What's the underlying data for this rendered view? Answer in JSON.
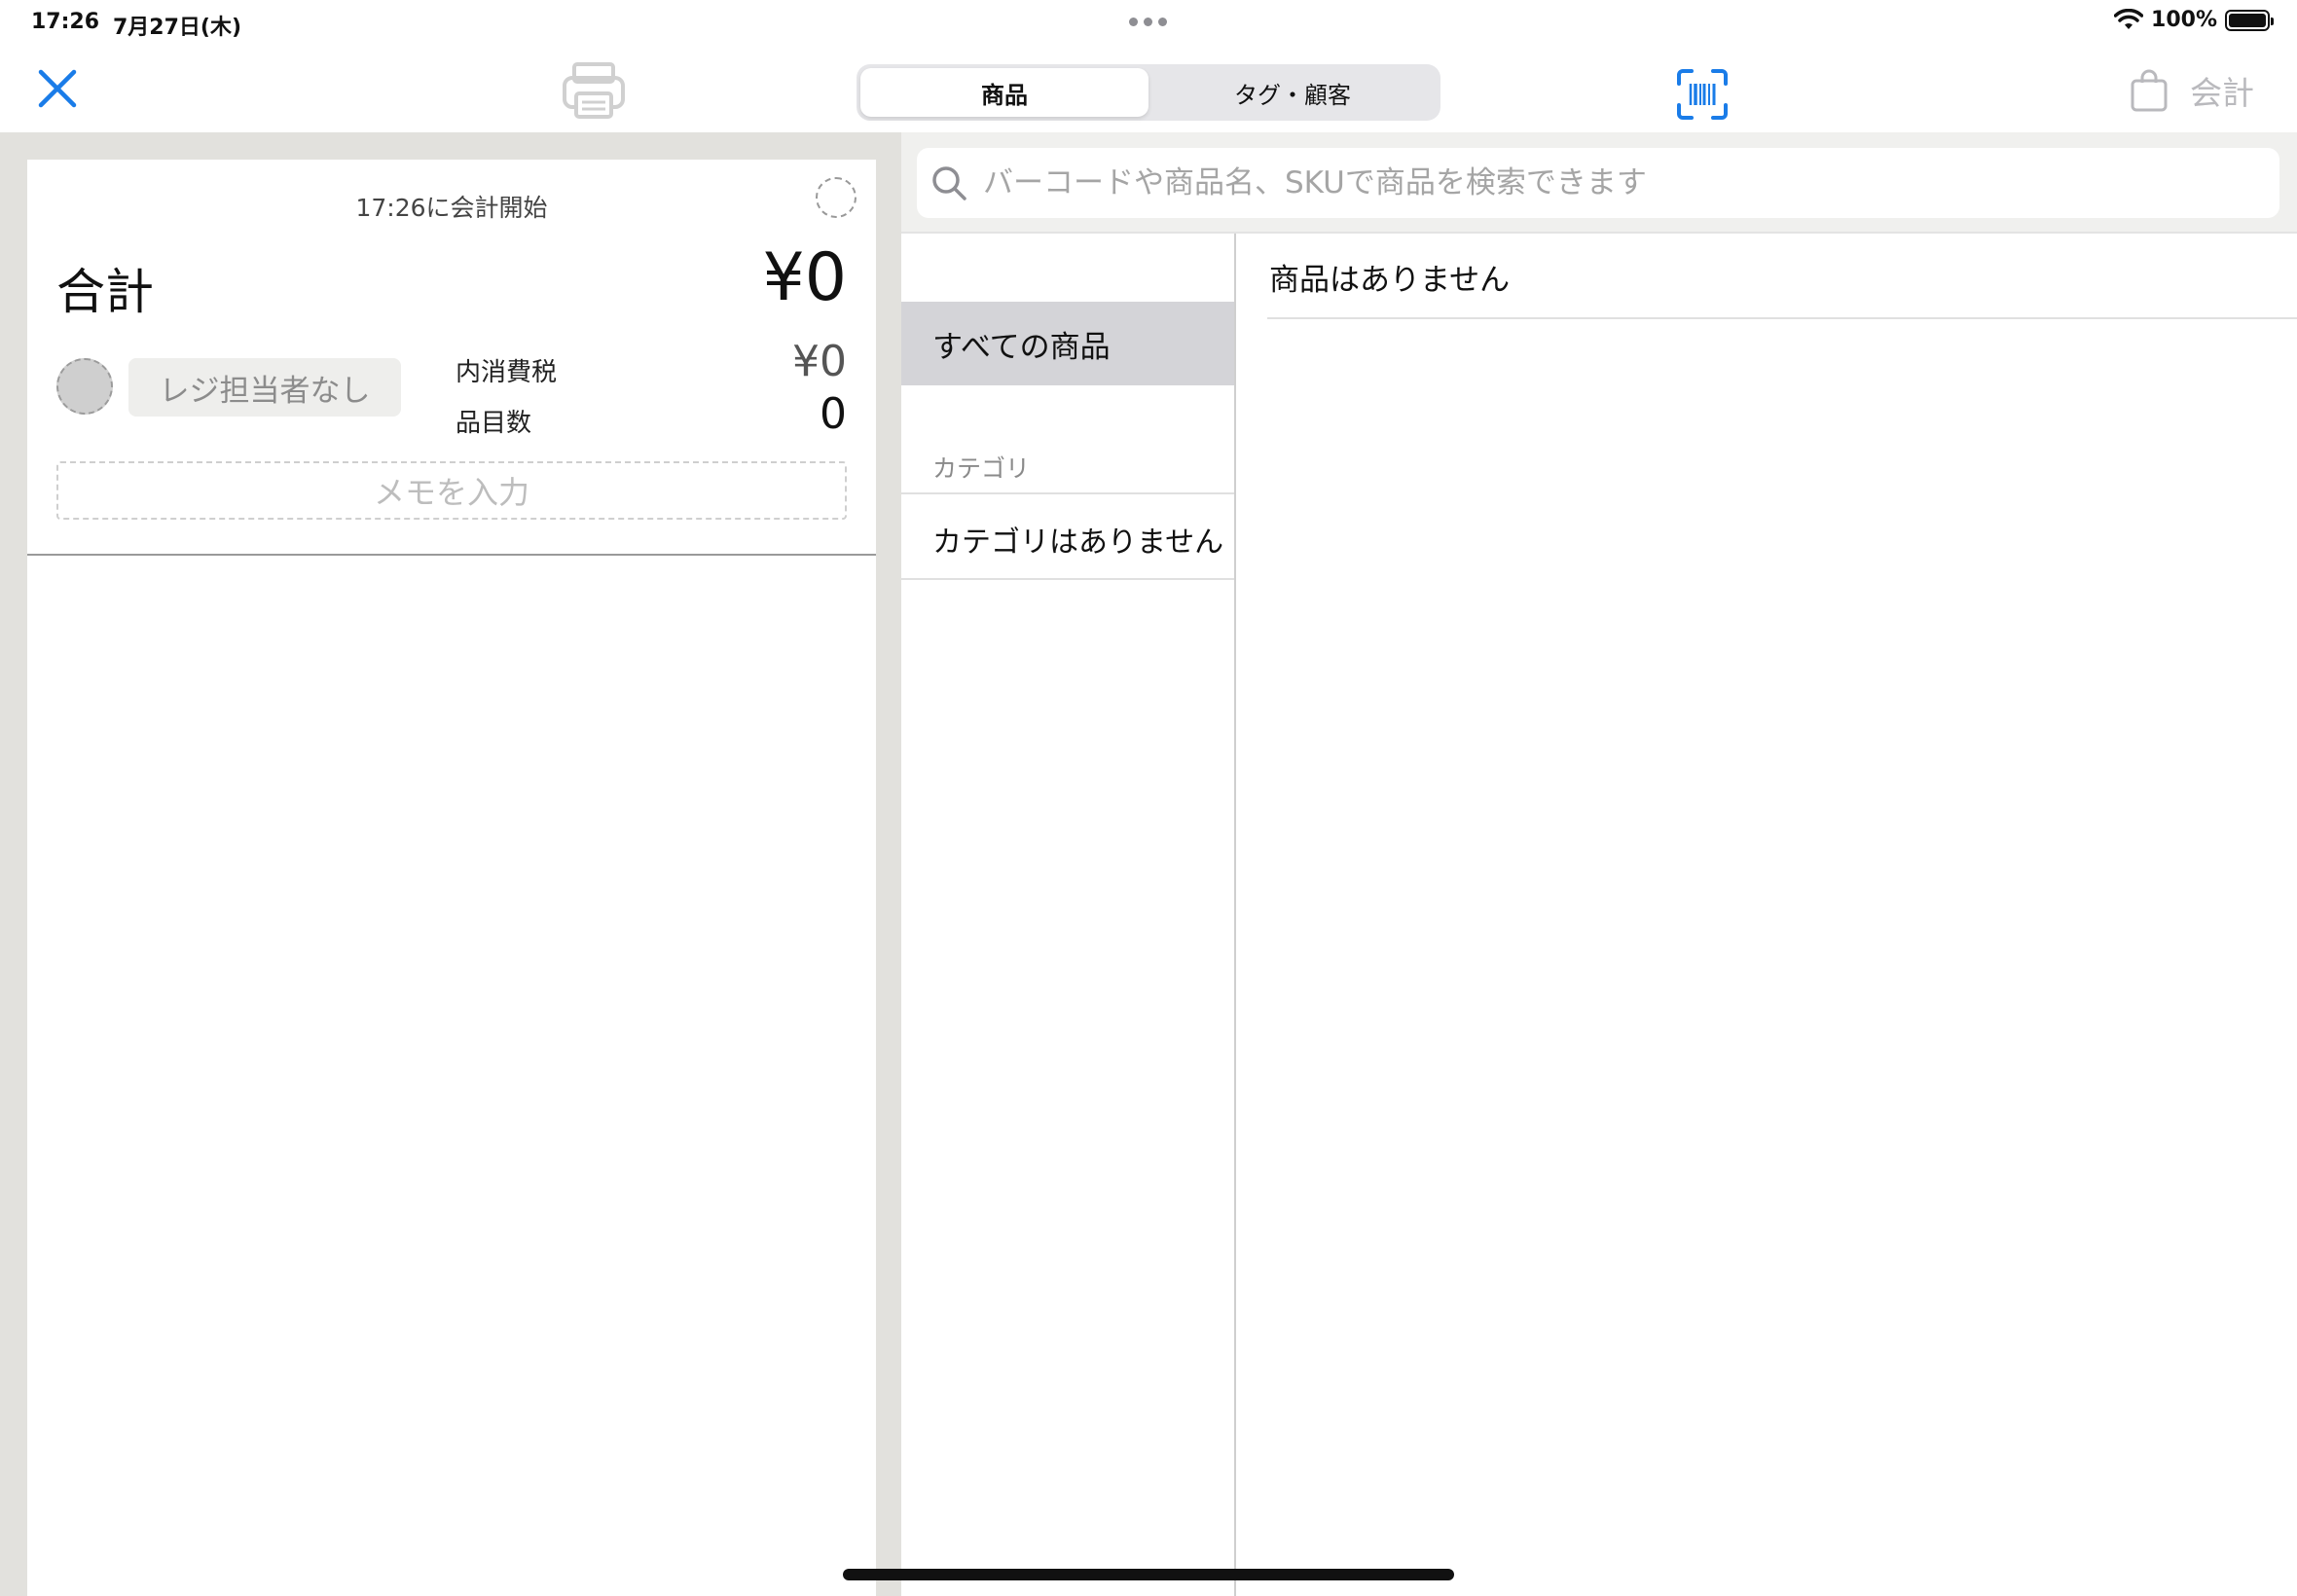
{
  "status_bar": {
    "time": "17:26",
    "date": "7月27日(木)",
    "battery": "100%"
  },
  "toolbar": {
    "close_icon": "close-icon",
    "print_icon": "printer-icon",
    "tabs": [
      {
        "label": "商品",
        "active": true
      },
      {
        "label": "タグ・顧客",
        "active": false
      }
    ],
    "scan_icon": "barcode-scan-icon",
    "checkout_label": "会計"
  },
  "cart": {
    "start_text": "17:26に会計開始",
    "total_label": "合計",
    "total_value": "¥0",
    "staff_label": "レジ担当者なし",
    "tax_label": "内消費税",
    "tax_value": "¥0",
    "count_label": "品目数",
    "count_value": "0",
    "memo_placeholder": "メモを入力"
  },
  "search": {
    "placeholder": "バーコードや商品名、SKUで商品を検索できます"
  },
  "sidebar": {
    "all_products": "すべての商品",
    "category_header": "カテゴリ",
    "no_categories": "カテゴリはありません"
  },
  "products": {
    "empty_text": "商品はありません"
  },
  "colors": {
    "accent": "#1a7ce8",
    "panel_bg": "#e2e1dd",
    "disabled": "#b9b9bd",
    "selected_row": "#d4d4d8"
  }
}
